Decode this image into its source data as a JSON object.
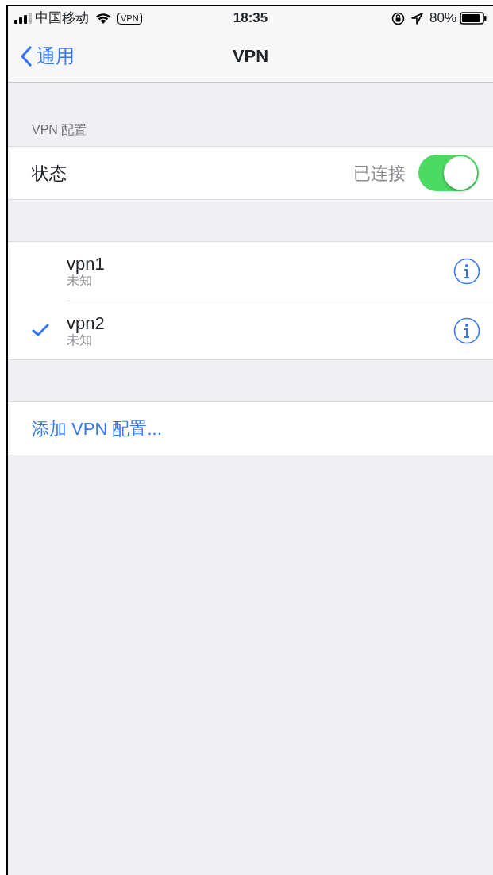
{
  "status_bar": {
    "carrier": "中国移动",
    "vpn_badge": "VPN",
    "time": "18:35",
    "battery": "80%"
  },
  "nav": {
    "back": "通用",
    "title": "VPN"
  },
  "section_header": "VPN 配置",
  "status_row": {
    "label": "状态",
    "value": "已连接",
    "on": true
  },
  "configs": [
    {
      "name": "vpn1",
      "status": "未知",
      "selected": false
    },
    {
      "name": "vpn2",
      "status": "未知",
      "selected": true
    }
  ],
  "add_label": "添加 VPN 配置..."
}
